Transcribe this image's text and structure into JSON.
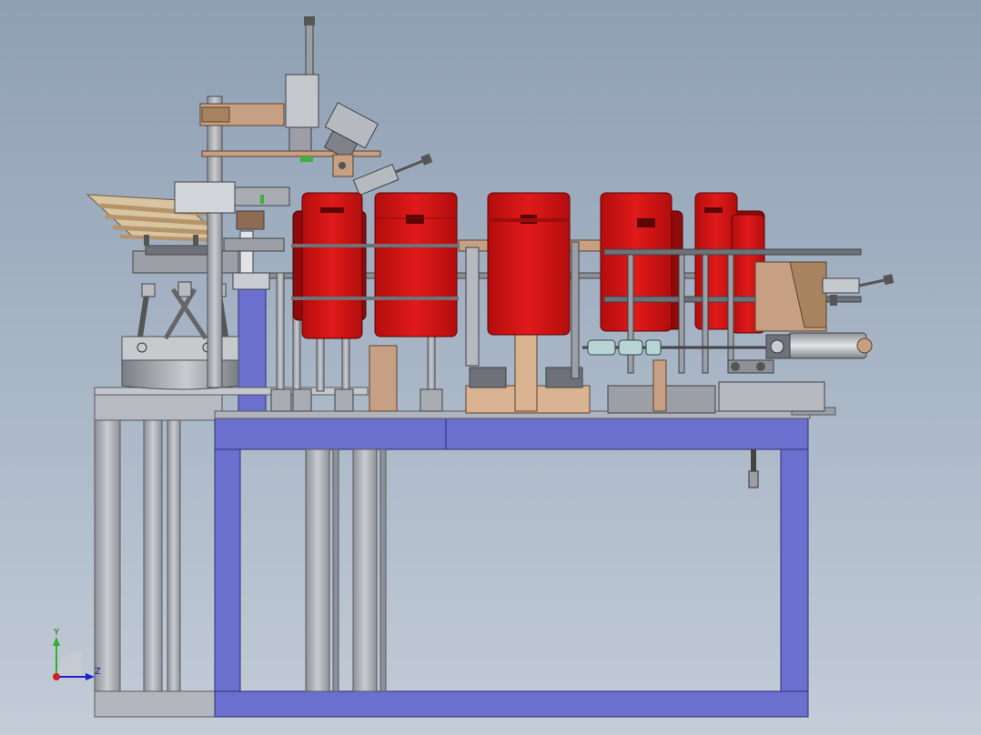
{
  "viewport": {
    "background_top": "#8fa0b3",
    "background_bottom": "#c3ccd7"
  },
  "colors": {
    "frame_blue": "#6b6fce",
    "frame_blue_dark": "#3b3f8e",
    "red_part": "#d11414",
    "red_dark": "#8f0a0a",
    "bronze": "#c39a7a",
    "steel": "#a9adb3",
    "steel_dark": "#6e7278"
  },
  "triad": {
    "icon": "coordinate-axes-icon",
    "y_label": "Y",
    "z_label": "Z"
  }
}
